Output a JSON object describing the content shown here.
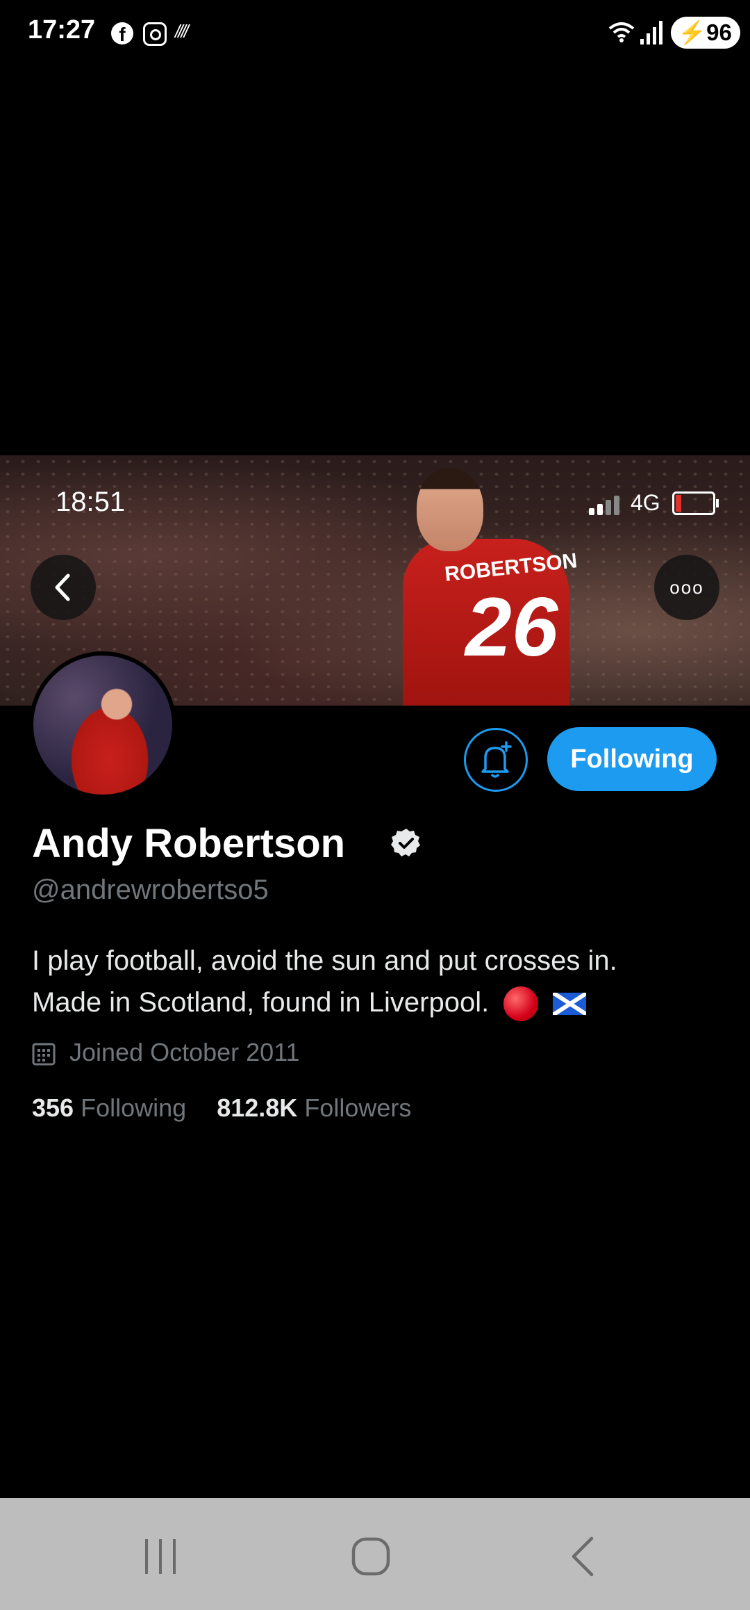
{
  "status_bar": {
    "time": "17:27",
    "battery": "96",
    "icons": [
      "facebook-icon",
      "instagram-icon",
      "misc-notification-icon",
      "wifi-icon",
      "signal-icon",
      "battery-charging-icon"
    ]
  },
  "screenshot": {
    "status_time": "18:51",
    "network": "4G",
    "more_label": "ooo"
  },
  "banner": {
    "jersey_name": "ROBERTSON",
    "jersey_number": "26"
  },
  "profile": {
    "display_name": "Andy Robertson",
    "handle": "@andrewrobertso5",
    "bio_line1": "I play football, avoid the sun and put crosses in.",
    "bio_line2": "Made in Scotland, found in Liverpool.",
    "joined": "Joined October 2011",
    "following_count": "356",
    "following_label": "Following",
    "followers_count": "812.8K",
    "followers_label": "Followers"
  },
  "actions": {
    "follow_label": "Following"
  },
  "colors": {
    "accent": "#1d9bf0",
    "secondary_text": "#71767b",
    "background": "#000000",
    "nav_bar": "#bdbdbd"
  }
}
